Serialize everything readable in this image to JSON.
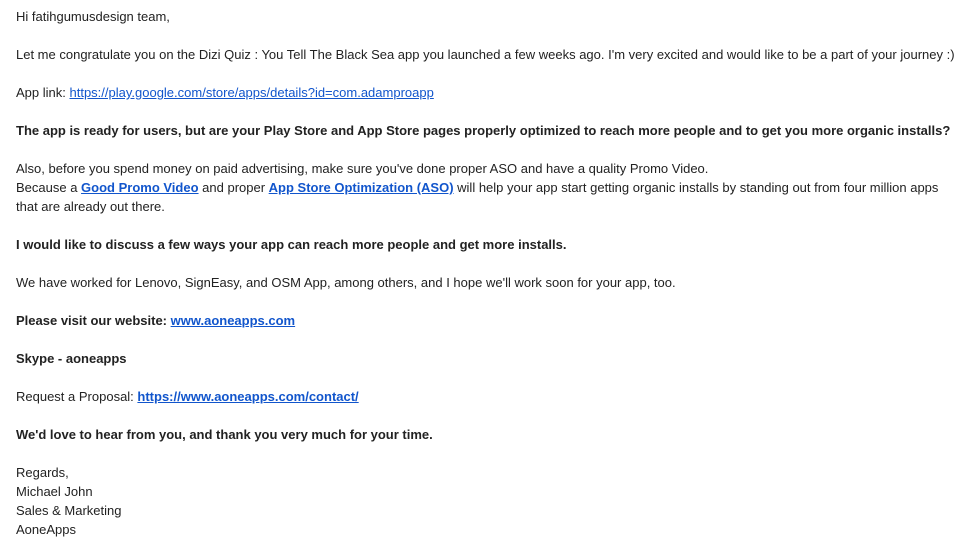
{
  "greeting": "Hi fatihgumusdesign team,",
  "congrats": "Let me congratulate you on the Dizi Quiz : You Tell The Black Sea app you launched a few weeks ago. I'm very excited and would like to be a part of your journey :)",
  "app_link": {
    "label": "App link: ",
    "url_text": "https://play.google.com/store/apps/details?id=com.adamproapp"
  },
  "question": "The app is ready for users, but are your Play Store and App Store pages properly optimized to reach more people and to get you more organic installs?",
  "aso": {
    "line1": "Also, before you spend money on paid advertising, make sure you've done proper ASO and have a quality Promo Video.",
    "line2_pre": "Because a ",
    "link1": "Good Promo Video",
    "line2_mid": " and proper ",
    "link2": "App Store Optimization (ASO)",
    "line2_post": " will help your app start getting organic installs by standing out from four million apps that are already out there."
  },
  "discuss": "I would like to discuss a few ways your app can reach more people and get more installs.",
  "clients": "We have worked for Lenovo, SignEasy, and OSM App, among others, and I hope we'll work soon for your app, too.",
  "website": {
    "label": "Please visit our website: ",
    "url_text": "www.aoneapps.com"
  },
  "skype": "Skype - aoneapps",
  "proposal": {
    "label": "Request a Proposal: ",
    "url_text": "https://www.aoneapps.com/contact/"
  },
  "closing": "We'd love to hear from you, and thank you very much for your time.",
  "signature": {
    "regards": "Regards,",
    "name": "Michael John",
    "title": "Sales & Marketing",
    "company": "AoneApps"
  },
  "colors": {
    "text": "#222222",
    "link": "#1155cc",
    "background": "#ffffff"
  }
}
